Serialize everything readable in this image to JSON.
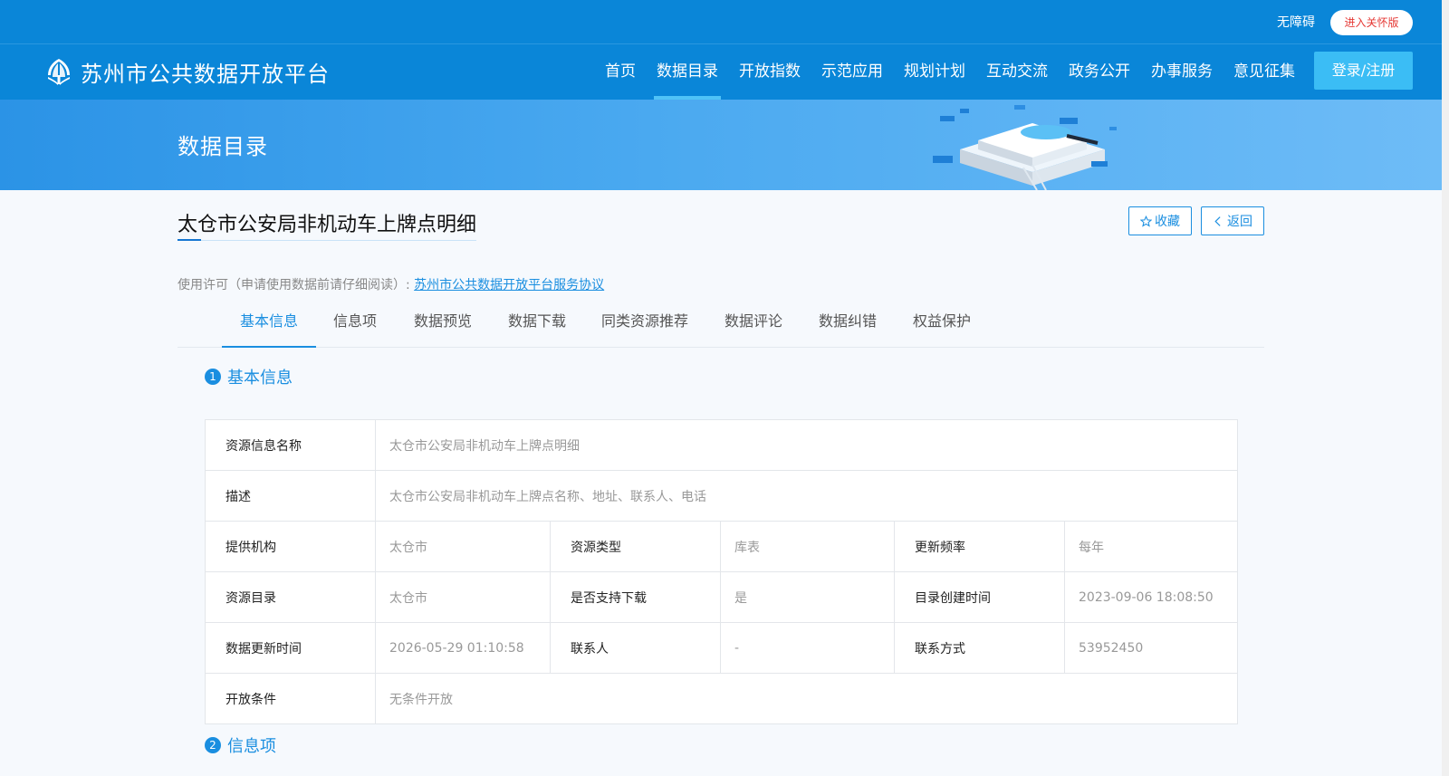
{
  "colors": {
    "primary": "#0a86d8",
    "accent": "#1a8ee0",
    "login": "#3bbdf5",
    "care_text": "#e53935"
  },
  "topbar": {
    "accessibility": "无障碍",
    "care_mode": "进入关怀版"
  },
  "header": {
    "logo_icon": "tree-leaf-logo-icon",
    "site_name": "苏州市公共数据开放平台",
    "nav": [
      {
        "label": "首页"
      },
      {
        "label": "数据目录",
        "active": true
      },
      {
        "label": "开放指数"
      },
      {
        "label": "示范应用"
      },
      {
        "label": "规划计划"
      },
      {
        "label": "互动交流"
      },
      {
        "label": "政务公开"
      },
      {
        "label": "办事服务"
      },
      {
        "label": "意见征集"
      }
    ],
    "login": "登录/注册"
  },
  "banner": {
    "title": "数据目录"
  },
  "resource": {
    "title": "太仓市公安局非机动车上牌点明细",
    "favorite": "收藏",
    "favorite_icon": "star-icon",
    "back": "返回",
    "back_icon": "chevron-left-icon",
    "license_label": "使用许可（申请使用数据前请仔细阅读）:",
    "license_link": "苏州市公共数据开放平台服务协议"
  },
  "tabs": [
    {
      "label": "基本信息",
      "active": true
    },
    {
      "label": "信息项"
    },
    {
      "label": "数据预览"
    },
    {
      "label": "数据下载"
    },
    {
      "label": "同类资源推荐"
    },
    {
      "label": "数据评论"
    },
    {
      "label": "数据纠错"
    },
    {
      "label": "权益保护"
    }
  ],
  "section1": {
    "num": "1",
    "title": "基本信息"
  },
  "section2": {
    "num": "2",
    "title": "信息项"
  },
  "basic_info": {
    "name_label": "资源信息名称",
    "name_value": "太仓市公安局非机动车上牌点明细",
    "desc_label": "描述",
    "desc_value": "太仓市公安局非机动车上牌点名称、地址、联系人、电话",
    "provider_label": "提供机构",
    "provider_value": "太仓市",
    "type_label": "资源类型",
    "type_value": "库表",
    "freq_label": "更新频率",
    "freq_value": "每年",
    "catalog_label": "资源目录",
    "catalog_value": "太仓市",
    "download_label": "是否支持下载",
    "download_value": "是",
    "created_label": "目录创建时间",
    "created_value": "2023-09-06 18:08:50",
    "updated_label": "数据更新时间",
    "updated_value": "2026-05-29 01:10:58",
    "contact_label": "联系人",
    "contact_value": "-",
    "phone_label": "联系方式",
    "phone_value": "53952450",
    "open_label": "开放条件",
    "open_value": "无条件开放"
  }
}
